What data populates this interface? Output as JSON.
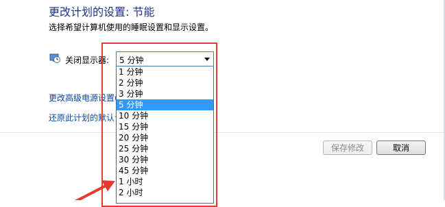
{
  "page": {
    "title": "更改计划的设置: 节能",
    "subtitle": "选择希望计算机使用的睡眠设置和显示设置。"
  },
  "display_setting": {
    "label": "关闭显示器:",
    "selected": "5 分钟",
    "options": [
      "1 分钟",
      "2 分钟",
      "3 分钟",
      "5 分钟",
      "10 分钟",
      "15 分钟",
      "20 分钟",
      "25 分钟",
      "30 分钟",
      "45 分钟",
      "1 小时",
      "2 小时"
    ],
    "selected_index": 3,
    "icon": "monitor-clock-icon"
  },
  "links": {
    "advanced": "更改高级电源设置(C)",
    "restore": "还原此计划的默认设置"
  },
  "buttons": {
    "save": "保存修改",
    "cancel": "取消"
  },
  "colors": {
    "title": "#1e3287",
    "link": "#0a47a9",
    "highlight": "#3399ff",
    "annotation": "#e53a2e"
  }
}
